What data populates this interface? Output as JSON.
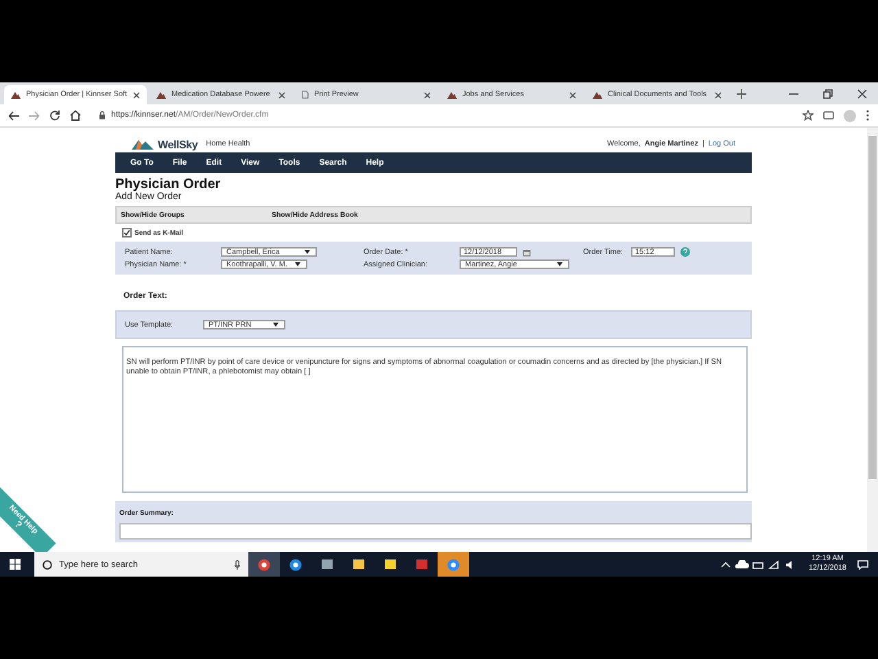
{
  "browser": {
    "tabs": [
      {
        "title": "Physician Order | Kinnser Soft",
        "kind": "site",
        "selected": true
      },
      {
        "title": "Medication Database Powere",
        "kind": "site",
        "selected": false
      },
      {
        "title": "Print Preview",
        "kind": "doc",
        "selected": false
      },
      {
        "title": "Jobs and Services",
        "kind": "site",
        "selected": false
      },
      {
        "title": "Clinical Documents and Tools",
        "kind": "site",
        "selected": false
      }
    ],
    "url_host": "https://kinnser.net",
    "url_path": "/AM/Order/NewOrder.cfm"
  },
  "page": {
    "brand": "WellSky",
    "product": "Home Health",
    "welcome": "Welcome,",
    "user": "Angie Martinez",
    "separator": "|",
    "logout": "Log Out",
    "menu": [
      "Go To",
      "File",
      "Edit",
      "View",
      "Tools",
      "Search",
      "Help"
    ],
    "title": "Physician Order",
    "subtitle": "Add New Order",
    "toolbar_links": [
      "Show/Hide Groups",
      "Show/Hide Address Book"
    ],
    "send_kmail": {
      "label": "Send as K-Mail",
      "checked": true
    },
    "patient_name": {
      "label": "Patient Name:",
      "value": "Campbell, Erica"
    },
    "physician_name": {
      "label": "Physician Name: *",
      "value": "Koothrapalli, V. M."
    },
    "order_date": {
      "label": "Order Date: *",
      "value": "12/12/2018"
    },
    "assigned_clinician": {
      "label": "Assigned Clinician:",
      "value": "Martinez, Angie"
    },
    "order_time": {
      "label": "Order Time:",
      "value": "15:12"
    },
    "order_text_label": "Order Text:",
    "template": {
      "label": "Use Template:",
      "value": "PT/INR PRN"
    },
    "order_text": "SN will perform PT/INR by point of care device or venipuncture for signs and symptoms of abnormal coagulation or coumadin concerns and as directed by [the physician.]  If SN unable to obtain PT/INR, a phlebotomist may obtain [ ]",
    "order_summary_label": "Order Summary:",
    "help_ribbon": {
      "text": "Need Help",
      "mark": "?"
    }
  },
  "taskbar": {
    "search_placeholder": "Type here to search",
    "apps": [
      {
        "kind": "chrome",
        "selected": true
      },
      {
        "kind": "edge",
        "selected": false
      },
      {
        "kind": "notes",
        "selected": false
      },
      {
        "kind": "folder",
        "selected": false
      },
      {
        "kind": "sticky",
        "selected": false
      },
      {
        "kind": "pdf",
        "selected": false
      },
      {
        "kind": "zoom",
        "selected": true
      }
    ],
    "time": "12:19 AM",
    "date": "12/12/2018"
  }
}
